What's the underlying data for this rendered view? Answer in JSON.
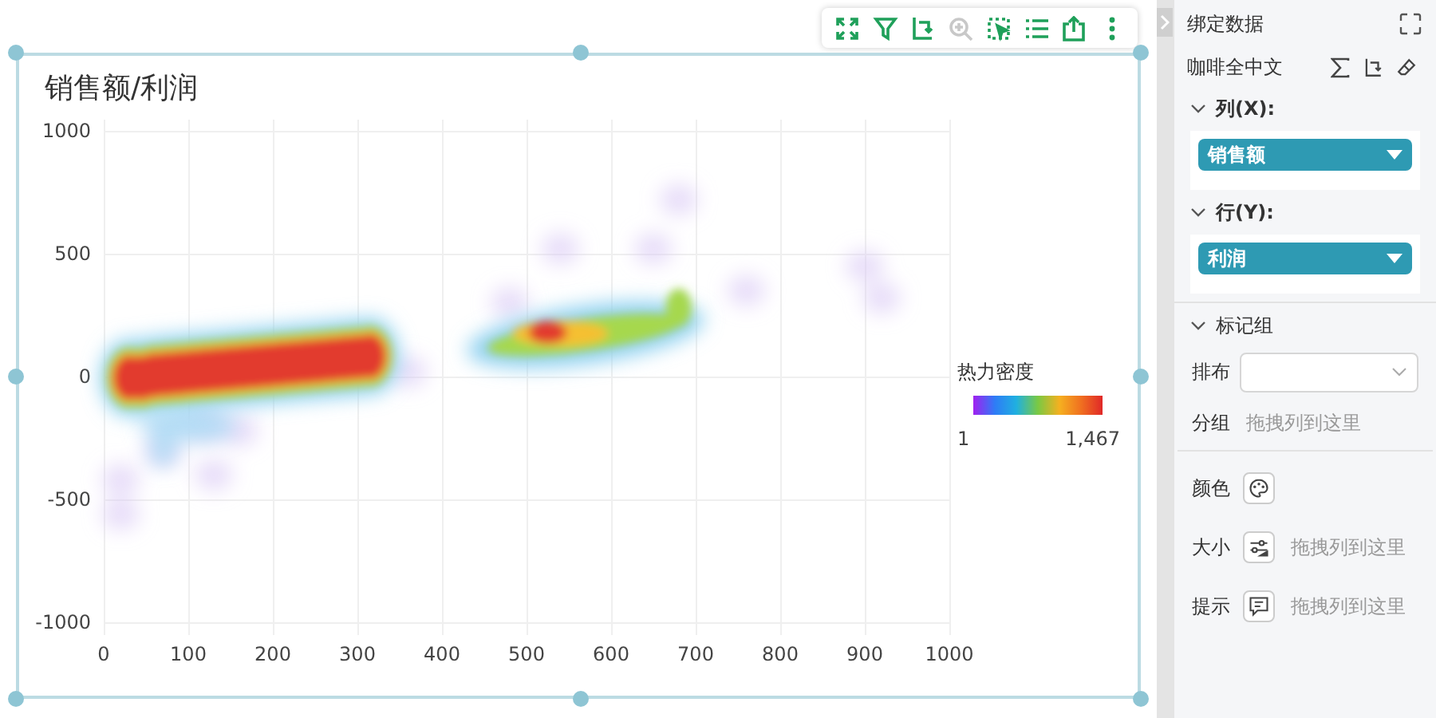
{
  "chart": {
    "title": "销售额/利润",
    "y_ticks": [
      "1000",
      "500",
      "0",
      "-500",
      "-1000"
    ],
    "x_ticks": [
      "0",
      "100",
      "200",
      "300",
      "400",
      "500",
      "600",
      "700",
      "800",
      "900",
      "1000"
    ],
    "legend": {
      "title": "热力密度",
      "min": "1",
      "max": "1,467"
    }
  },
  "toolbar": [
    {
      "kind": "expand",
      "disabled": false
    },
    {
      "kind": "filter",
      "disabled": false
    },
    {
      "kind": "swap",
      "disabled": false
    },
    {
      "kind": "zoom",
      "disabled": true
    },
    {
      "kind": "select",
      "disabled": false
    },
    {
      "kind": "list",
      "disabled": false
    },
    {
      "kind": "export",
      "disabled": false
    },
    {
      "kind": "more",
      "disabled": false
    }
  ],
  "panel": {
    "title": "绑定数据",
    "dataset": "咖啡全中文",
    "axes": [
      {
        "label": "列(X):",
        "field": "销售额",
        "expanded": true
      },
      {
        "label": "行(Y):",
        "field": "利润",
        "expanded": true
      }
    ],
    "marks": {
      "title": "标记组",
      "expanded": true,
      "layout_label": "排布",
      "group_label": "分组",
      "group_hint": "拖拽列到这里",
      "encodings": [
        {
          "label": "颜色",
          "kind": "color"
        },
        {
          "label": "大小",
          "kind": "size",
          "hint": "拖拽列到这里"
        },
        {
          "label": "提示",
          "kind": "tooltip",
          "hint": "拖拽列到这里"
        }
      ]
    }
  }
}
